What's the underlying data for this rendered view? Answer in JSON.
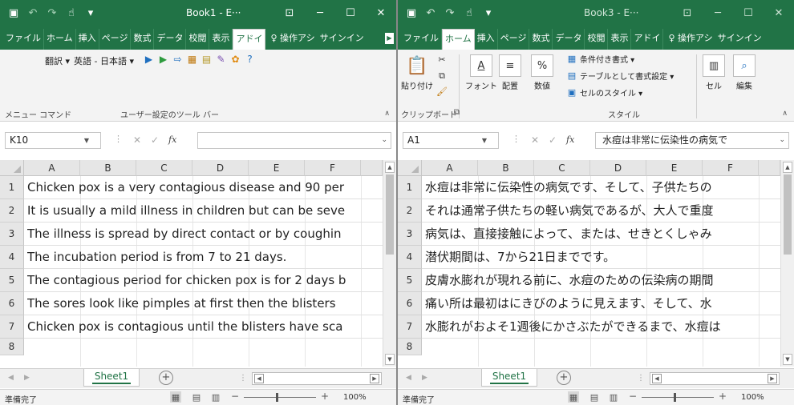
{
  "left": {
    "title": "Book1 - E···",
    "tabs": [
      "ファイル",
      "ホーム",
      "挿入",
      "ページ",
      "数式",
      "データ",
      "校閲",
      "表示",
      "アドイ"
    ],
    "tell_me": "操作アシ",
    "sign_in": "サインイン",
    "ribbon": {
      "translate": "翻訳 ▾",
      "lang_pair": "英語 - 日本語 ▾",
      "group_menu": "メニュー コマンド",
      "group_custom": "ユーザー設定のツール バー"
    },
    "name_box": "K10",
    "formula": "",
    "columns": [
      "A",
      "B",
      "C",
      "D",
      "E",
      "F"
    ],
    "rows": [
      {
        "num": "1",
        "text": "Chicken pox is a very contagious disease and 90 per"
      },
      {
        "num": "2",
        "text": "It is usually a mild illness in children but can be seve"
      },
      {
        "num": "3",
        "text": "The illness is spread by direct contact or by coughin"
      },
      {
        "num": "4",
        "text": "The incubation period is from 7 to 21 days."
      },
      {
        "num": "5",
        "text": "The contagious period for chicken pox is for 2 days b"
      },
      {
        "num": "6",
        "text": "The sores look like pimples at first then the blisters"
      },
      {
        "num": "7",
        "text": "Chicken pox is contagious until the blisters have sca"
      },
      {
        "num": "8",
        "text": ""
      }
    ],
    "sheet": "Sheet1",
    "status": "準備完了",
    "zoom": "100%"
  },
  "right": {
    "title": "Book3 - E···",
    "tabs": [
      "ファイル",
      "ホーム",
      "挿入",
      "ページ",
      "数式",
      "データ",
      "校閲",
      "表示",
      "アドイ"
    ],
    "tell_me": "操作アシ",
    "sign_in": "サインイン",
    "ribbon": {
      "paste": "貼り付け",
      "font": "フォント",
      "align": "配置",
      "number": "数値",
      "cond_format": "条件付き書式 ▾",
      "table_format": "テーブルとして書式設定 ▾",
      "cell_style": "セルのスタイル ▾",
      "cells": "セル",
      "edit": "編集",
      "group_clipboard": "クリップボード",
      "group_style": "スタイル"
    },
    "name_box": "A1",
    "formula": "水痘は非常に伝染性の病気で",
    "columns": [
      "A",
      "B",
      "C",
      "D",
      "E",
      "F"
    ],
    "rows": [
      {
        "num": "1",
        "text": "水痘は非常に伝染性の病気です、そして、子供たちの"
      },
      {
        "num": "2",
        "text": "それは通常子供たちの軽い病気であるが、大人で重度"
      },
      {
        "num": "3",
        "text": "病気は、直接接触によって、または、せきとくしゃみ"
      },
      {
        "num": "4",
        "text": "潜伏期間は、7から21日までです。"
      },
      {
        "num": "5",
        "text": "皮膚水膨れが現れる前に、水痘のための伝染病の期間"
      },
      {
        "num": "6",
        "text": "痛い所は最初はにきびのように見えます、そして、水"
      },
      {
        "num": "7",
        "text": "水膨れがおよそ1週後にかさぶたができるまで、水痘は"
      },
      {
        "num": "8",
        "text": ""
      }
    ],
    "sheet": "Sheet1",
    "status": "準備完了",
    "zoom": "100%"
  }
}
